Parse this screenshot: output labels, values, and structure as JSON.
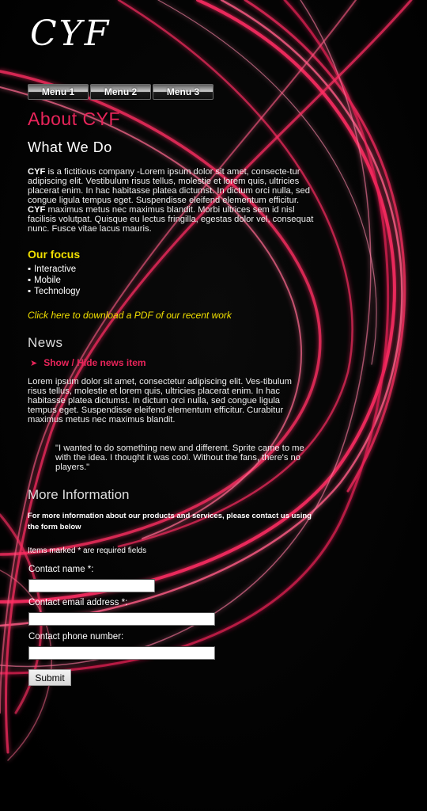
{
  "logo": "CYF",
  "menu": {
    "items": [
      "Menu 1",
      "Menu 2",
      "Menu 3"
    ]
  },
  "about": {
    "title": "About CYF",
    "subtitle": "What We Do",
    "para_lead": "CYF",
    "para_part1": " is a fictitious company -Lorem ipsum dolor sit amet, consecte-tur adipiscing elit. Vestibulum risus tellus, molestie et lorem quis, ultricies placerat enim. In hac habitasse platea dictumst. In dictum orci nulla, sed congue ligula tempus eget. Suspendisse eleifend elementum efficitur. ",
    "para_bold2": "CYF",
    "para_part2": " maximus metus nec maximus blandit. Morbi ultrices sem id nisl facilisis volutpat. Quisque eu lectus fringilla, egestas dolor vel, consequat nunc. Fusce vitae lacus mauris."
  },
  "focus": {
    "title": "Our focus",
    "items": [
      "Interactive",
      "Mobile",
      "Technology"
    ]
  },
  "pdf_link": "Click here to download a PDF of our recent work",
  "news": {
    "title": "News",
    "toggle_label": "Show / Hide news item",
    "text": "Lorem ipsum dolor sit amet, consectetur adipiscing elit. Ves-tibulum risus tellus, molestie et lorem quis, ultricies placerat enim. In hac habitasse platea dictumst. In dictum orci nulla, sed congue ligula tempus eget. Suspendisse eleifend elementum efficitur. Curabitur maximus metus nec maximus blandit.",
    "quote": "\"I wanted to do something new and different. Sprite came to me with the idea. I thought it was cool. Without the fans, there's no players.\""
  },
  "more_info": {
    "title": "More Information",
    "text": "For more information about our products and services, please contact us using the form below",
    "required_note": "Items marked * are required fields"
  },
  "form": {
    "name_label": "Contact name *:",
    "email_label": "Contact email address *:",
    "phone_label": "Contact phone number:",
    "name_value": "",
    "email_value": "",
    "phone_value": "",
    "submit_label": "Submit"
  },
  "colors": {
    "accent_pink": "#e8245a",
    "accent_yellow": "#f2e000",
    "background": "#020202"
  },
  "icons": {
    "news_toggle": "arrow-right-icon"
  }
}
